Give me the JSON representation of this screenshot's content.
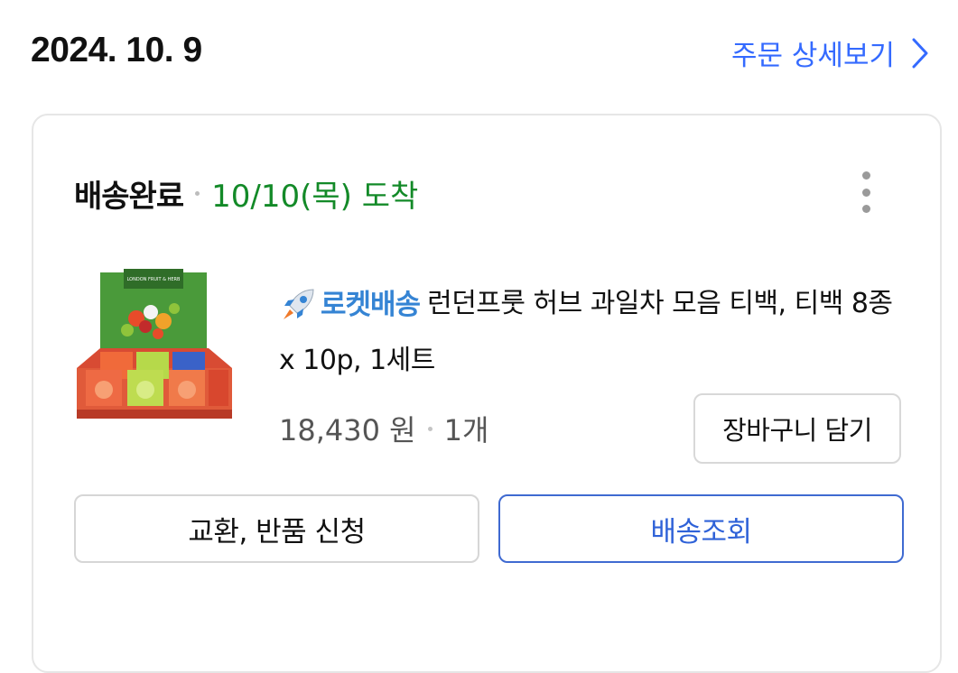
{
  "order": {
    "date": "2024. 10. 9",
    "detail_link_label": "주문 상세보기"
  },
  "shipment": {
    "status": "배송완료",
    "arrival": "10/10(목) 도착"
  },
  "product": {
    "rocket_label": "로켓배송",
    "title": "런던프룻 허브 과일차 모음 티백, 티백 8종 x 10p, 1세트",
    "image_brand_text": "LONDON FRUIT & HERB",
    "price": "18,430 원",
    "quantity": "1개"
  },
  "buttons": {
    "add_to_cart": "장바구니 담기",
    "exchange_return": "교환, 반품 신청",
    "track_delivery": "배송조회"
  },
  "icons": {
    "detail_chevron": "chevron-right-icon",
    "more": "more-vertical-icon",
    "rocket": "rocket-icon"
  },
  "colors": {
    "link_blue": "#346aff",
    "arrival_green": "#138a28",
    "rocket_blue": "#3584d4",
    "track_border": "#3f6ad1"
  }
}
